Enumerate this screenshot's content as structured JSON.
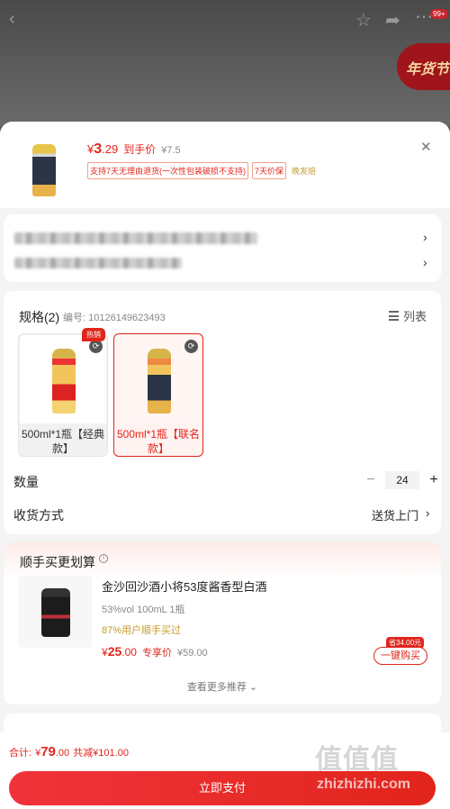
{
  "topbar": {
    "back_icon": "chevron-left-icon",
    "star_icon": "star-icon",
    "share_icon": "share-icon",
    "more_icon": "more-icon",
    "badge": "99+",
    "banner": "年货节"
  },
  "product": {
    "price_symbol": "¥",
    "price_int": "3",
    "price_dec": ".29",
    "price_tag": "到手价",
    "original_price": "¥7.5",
    "tags": [
      "支持7天无理由退货(一次性包装破损不支持)",
      "7天价保"
    ],
    "tag_plain": "晚发赔"
  },
  "spec": {
    "title": "规格(2)",
    "code": "编号: 10126149623493",
    "list_label": "列表",
    "options": [
      {
        "label": "500ml*1瓶【经典款】",
        "hot": "热销",
        "selected": false
      },
      {
        "label": "500ml*1瓶【联名款】",
        "hot": "",
        "selected": true
      }
    ],
    "quantity_label": "数量",
    "quantity": "24",
    "minus": "−",
    "plus": "+",
    "delivery_label": "收货方式",
    "delivery_value": "送货上门"
  },
  "combo": {
    "title": "顺手买更划算",
    "info": "i",
    "name": "金沙回沙酒小将53度酱香型白酒",
    "spec": "53%vol 100mL 1瓶",
    "buyers": "87%用户顺手买过",
    "price_symbol": "¥",
    "price_int": "25",
    "price_dec": ".00",
    "price_tag": "专享价",
    "original_price": "¥59.00",
    "save_badge": "省34.00元",
    "button": "一键购买",
    "more": "查看更多推荐"
  },
  "footer": {
    "total_label": "合计:",
    "total_symbol": "¥",
    "total_int": "79",
    "total_dec": ".00",
    "discount": "共减¥101.00",
    "pay_button": "立即支付",
    "watermark": "值值值",
    "watermark_url": "zhizhizhi.com"
  }
}
